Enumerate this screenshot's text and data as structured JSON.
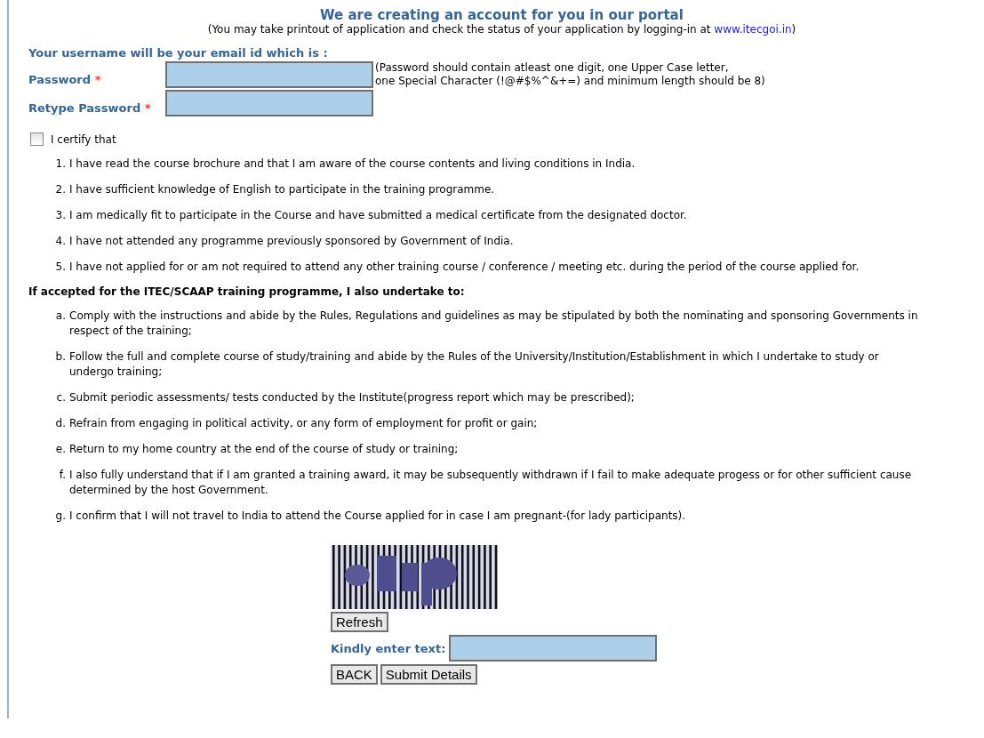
{
  "header": {
    "title": "We are creating an account for you in our portal",
    "note_before": "(You may take printout of application and check the status of your application by logging-in at ",
    "link": "www.itecgoi.in",
    "note_after": ")"
  },
  "username_label": "Your username will be your email id which is :",
  "fields": [
    {
      "label": "Password",
      "required_mark": "*",
      "hint_lines": [
        "(Password should contain atleast one digit, one Upper Case letter,",
        "one Special Character (!@#$%^&+=) and minimum length should be 8)"
      ]
    },
    {
      "label": "Retype Password",
      "required_mark": "*"
    }
  ],
  "certify": {
    "label": "I certify that",
    "checked": false
  },
  "certify_items": [
    {
      "marker": "1.",
      "text": "I have read the course brochure and that I am aware of the course contents and living conditions in India."
    },
    {
      "marker": "2.",
      "text": "I have sufficient knowledge of English to participate in the training programme."
    },
    {
      "marker": "3.",
      "text": "I am medically fit to participate in the Course and have submitted a medical certificate from the designated doctor."
    },
    {
      "marker": "4.",
      "text": "I have not attended any programme previously sponsored by Government of India."
    },
    {
      "marker": "5.",
      "text": "I have not applied for or am not required to attend any other training course / conference / meeting etc. during the period of the course applied for."
    }
  ],
  "undertake_heading": "If accepted for the ITEC/SCAAP training programme, I also undertake to:",
  "undertake_items": [
    {
      "marker": "a.",
      "text": "Comply with the instructions and abide by the Rules, Regulations and guidelines as may be stipulated by both the nominating and sponsoring Governments in respect of the training;"
    },
    {
      "marker": "b.",
      "text": "Follow the full and complete course of study/training and abide by the Rules of the University/Institution/Establishment in which I undertake to study or undergo training;"
    },
    {
      "marker": "c.",
      "text": "Submit periodic assessments/ tests conducted by the Institute(progress report which may be prescribed);"
    },
    {
      "marker": "d.",
      "text": "Refrain from engaging in political activity, or any form of employment for profit or gain;"
    },
    {
      "marker": "e.",
      "text": "Return to my home country at the end of the course of study or training;"
    },
    {
      "marker": "f.",
      "text": "I also fully understand that if I am granted a training award, it may be subsequently withdrawn if I fail to make adequate progess or for other sufficient cause determined by the host Government."
    },
    {
      "marker": "g.",
      "text": "I confirm that I will not travel to India to attend the Course applied for in case I am pregnant-(for lady participants)."
    }
  ],
  "captcha": {
    "kind": "picture",
    "refresh_button": "Refresh",
    "input_label": "Kindly enter text:"
  },
  "buttons": [
    "BACK",
    "Submit Details"
  ]
}
